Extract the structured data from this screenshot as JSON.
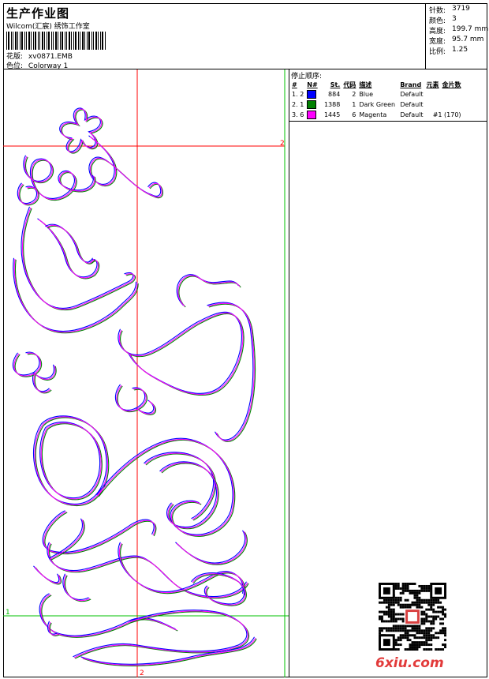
{
  "header": {
    "title": "生产作业图",
    "company": "Wilcom(汇宸) 绣饰工作室",
    "design_label": "花版:",
    "design_value": "xv0871.EMB",
    "colorway_label": "色位:",
    "colorway_value": "Colorway 1"
  },
  "stats": [
    {
      "label": "针数:",
      "value": "3719"
    },
    {
      "label": "颜色:",
      "value": "3"
    },
    {
      "label": "高度:",
      "value": "199.7 mm"
    },
    {
      "label": "宽度:",
      "value": "95.7 mm"
    },
    {
      "label": "比例:",
      "value": "1.25"
    }
  ],
  "stop_sequence": {
    "title": "停止顺序:",
    "columns": [
      "#",
      "N#",
      "St.",
      "代码",
      "描述",
      "Brand",
      "元素",
      "金片数"
    ],
    "rows": [
      {
        "idx": "1.",
        "n": "2",
        "color": "#0000ff",
        "st": "884",
        "code": "2",
        "desc": "Blue",
        "brand": "Default",
        "element": "",
        "sequins": ""
      },
      {
        "idx": "2.",
        "n": "1",
        "color": "#008000",
        "st": "1388",
        "code": "1",
        "desc": "Dark Green",
        "brand": "Default",
        "element": "",
        "sequins": ""
      },
      {
        "idx": "3.",
        "n": "6",
        "color": "#ff00ff",
        "st": "1445",
        "code": "6",
        "desc": "Magenta",
        "brand": "Default",
        "element": "#1 (170)",
        "sequins": ""
      }
    ]
  },
  "guides": {
    "top_right_marker": "2",
    "bottom_marker": "2",
    "left_marker": "1",
    "line_color": "#ff0000",
    "green_line_color": "#00c000"
  },
  "stitch_colors": {
    "blue": "#0000ff",
    "green": "#008000",
    "magenta": "#ff00ff"
  },
  "watermark": "6xiu.com"
}
